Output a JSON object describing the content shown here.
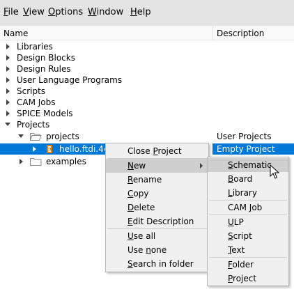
{
  "menubar": {
    "items": [
      {
        "first": "F",
        "rest": "ile"
      },
      {
        "first": "V",
        "rest": "iew"
      },
      {
        "first": "O",
        "rest": "ptions"
      },
      {
        "first": "W",
        "rest": "indow"
      },
      {
        "first": "H",
        "rest": "elp"
      }
    ]
  },
  "tree": {
    "columns": {
      "name": "Name",
      "description": "Description"
    },
    "rows": [
      {
        "label": "Libraries"
      },
      {
        "label": "Design Blocks"
      },
      {
        "label": "Design Rules"
      },
      {
        "label": "User Language Programs"
      },
      {
        "label": "Scripts"
      },
      {
        "label": "CAM Jobs"
      },
      {
        "label": "SPICE Models"
      },
      {
        "label": "Projects"
      },
      {
        "label": "projects",
        "description": "User Projects"
      },
      {
        "label": "hello.ftdi.44",
        "description": "Empty Project"
      },
      {
        "label": "examples"
      }
    ]
  },
  "context_menu": {
    "items": [
      {
        "first": "Close ",
        "u": "P",
        "rest": "roject"
      },
      {
        "first": "",
        "u": "N",
        "rest": "ew"
      },
      {
        "first": "",
        "u": "R",
        "rest": "ename"
      },
      {
        "first": "",
        "u": "C",
        "rest": "opy"
      },
      {
        "first": "",
        "u": "D",
        "rest": "elete"
      },
      {
        "first": "",
        "u": "E",
        "rest": "dit Description"
      },
      {
        "first": "",
        "u": "U",
        "rest": "se all"
      },
      {
        "first": "Use ",
        "u": "n",
        "rest": "one"
      },
      {
        "first": "",
        "u": "S",
        "rest": "earch in folder"
      }
    ]
  },
  "submenu": {
    "items": [
      {
        "first": "",
        "u": "S",
        "rest": "chematic"
      },
      {
        "first": "",
        "u": "B",
        "rest": "oard"
      },
      {
        "first": "",
        "u": "L",
        "rest": "ibrary"
      },
      {
        "first": "CAM ",
        "u": "J",
        "rest": "ob"
      },
      {
        "first": "",
        "u": "U",
        "rest": "LP"
      },
      {
        "first": "",
        "u": "S",
        "rest": "cript"
      },
      {
        "first": "",
        "u": "T",
        "rest": "ext"
      },
      {
        "first": "",
        "u": "F",
        "rest": "older"
      },
      {
        "first": "",
        "u": "P",
        "rest": "roject"
      }
    ]
  },
  "colors": {
    "selection": "#0078d7",
    "menu_bg": "#f0f0f0",
    "menu_highlight": "#cfcfcf",
    "folder": "#fff3c4",
    "project_icon": "#e07a10"
  }
}
